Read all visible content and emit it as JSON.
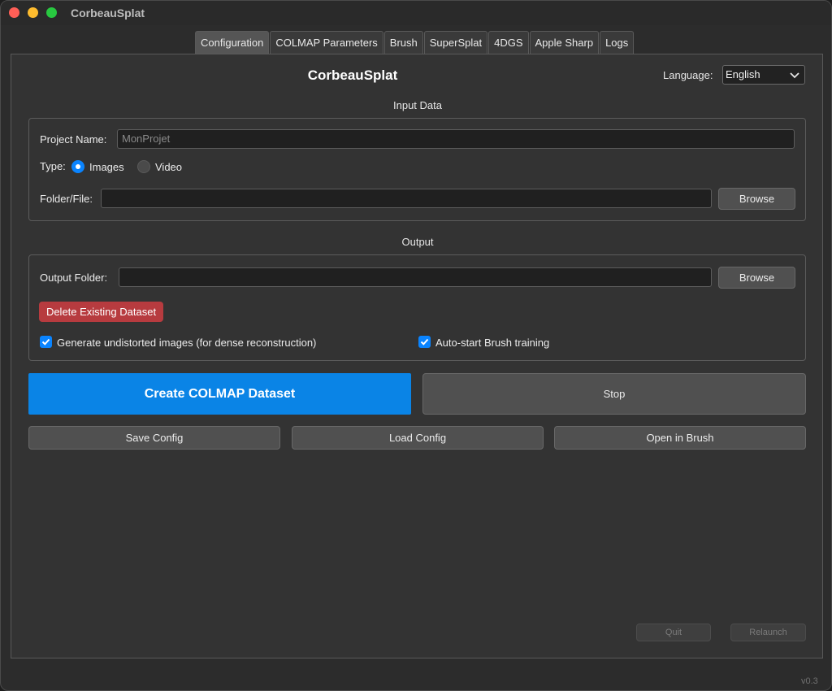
{
  "app": {
    "title": "CorbeauSplat",
    "version": "v0.3"
  },
  "tabs": [
    {
      "label": "Configuration",
      "active": true
    },
    {
      "label": "COLMAP Parameters"
    },
    {
      "label": "Brush"
    },
    {
      "label": "SuperSplat"
    },
    {
      "label": "4DGS"
    },
    {
      "label": "Apple Sharp"
    },
    {
      "label": "Logs"
    }
  ],
  "header": {
    "title": "CorbeauSplat",
    "language_label": "Language:",
    "language_value": "English"
  },
  "input_data": {
    "section_title": "Input Data",
    "project_name_label": "Project Name:",
    "project_name_placeholder": "MonProjet",
    "project_name_value": "",
    "type_label": "Type:",
    "type_options": [
      {
        "label": "Images",
        "selected": true
      },
      {
        "label": "Video",
        "selected": false
      }
    ],
    "folder_label": "Folder/File:",
    "folder_value": "",
    "browse_label": "Browse"
  },
  "output": {
    "section_title": "Output",
    "folder_label": "Output Folder:",
    "folder_value": "",
    "browse_label": "Browse",
    "delete_label": "Delete Existing Dataset",
    "undistort_label": "Generate undistorted images (for dense reconstruction)",
    "undistort_checked": true,
    "autostart_label": "Auto-start Brush training",
    "autostart_checked": true
  },
  "actions": {
    "create_label": "Create COLMAP Dataset",
    "stop_label": "Stop",
    "save_label": "Save Config",
    "load_label": "Load Config",
    "open_brush_label": "Open in Brush",
    "quit_label": "Quit",
    "relaunch_label": "Relaunch"
  },
  "colors": {
    "accent": "#0a84e6",
    "danger": "#b73b3f",
    "background": "#333333"
  }
}
